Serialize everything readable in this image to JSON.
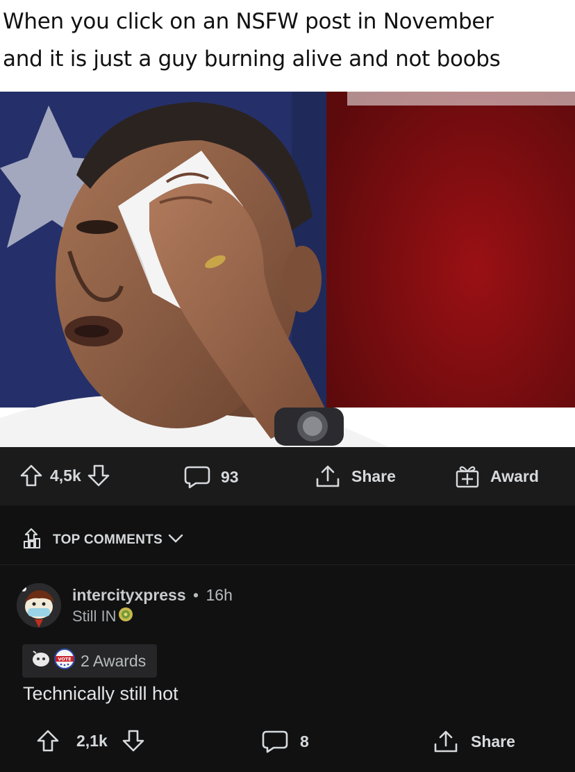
{
  "meme": {
    "line1": "When you click on an NSFW post in November",
    "line2": "and it is just a guy burning alive and not boobs"
  },
  "post_actions": {
    "upvotes": "4,5k",
    "comments": "93",
    "share_label": "Share",
    "award_label": "Award"
  },
  "comments_header": {
    "sort_label": "TOP COMMENTS"
  },
  "comment": {
    "author": "intercityxpress",
    "separator": "•",
    "time": "16h",
    "flair": "Still IN",
    "awards_label": "2 Awards",
    "award_badge_text": "VOTE",
    "body": "Technically still hot",
    "upvotes": "2,1k",
    "replies": "8",
    "share_label": "Share"
  },
  "colors": {
    "bar_bg": "#1b1b1c",
    "page_bg": "#111112",
    "text": "#d7dadc",
    "flag_red": "#8f0f12",
    "flag_blue": "#1f2a5a"
  }
}
